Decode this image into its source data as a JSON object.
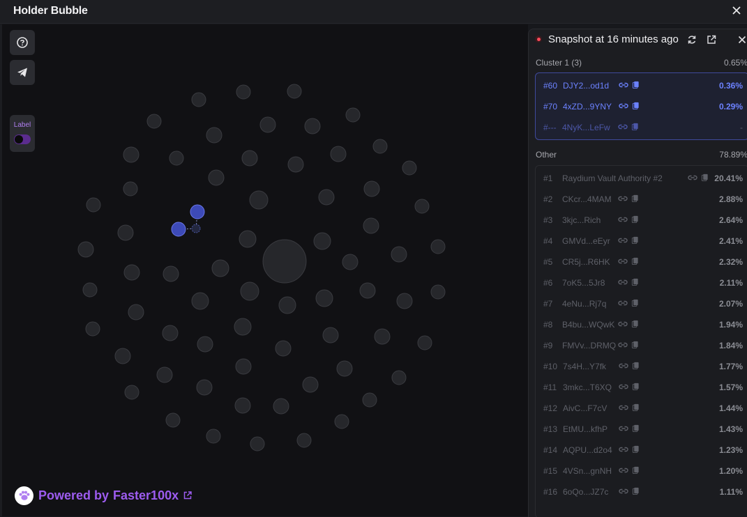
{
  "window": {
    "title": "Holder Bubble"
  },
  "toolbar": {
    "label_text": "Label"
  },
  "footer": {
    "powered_by": "Powered by",
    "brand": "Faster100x"
  },
  "panel": {
    "snapshot_text": "Snapshot at 16 minutes ago",
    "cluster": {
      "label": "Cluster 1 (3)",
      "total": "0.65%",
      "rows": [
        {
          "rank": "#60",
          "address": "DJY2...od1d",
          "percent": "0.36%"
        },
        {
          "rank": "#70",
          "address": "4xZD...9YNY",
          "percent": "0.29%"
        },
        {
          "rank": "#---",
          "address": "4NyK...LeFw",
          "percent": "-"
        }
      ]
    },
    "other": {
      "label": "Other",
      "total": "78.89%",
      "rows": [
        {
          "rank": "#1",
          "address": "Raydium Vault Authority #2",
          "percent": "20.41%"
        },
        {
          "rank": "#2",
          "address": "CKcr...4MAM",
          "percent": "2.88%"
        },
        {
          "rank": "#3",
          "address": "3kjc...Rich",
          "percent": "2.64%"
        },
        {
          "rank": "#4",
          "address": "GMVd...eEyr",
          "percent": "2.41%"
        },
        {
          "rank": "#5",
          "address": "CR5j...R6HK",
          "percent": "2.32%"
        },
        {
          "rank": "#6",
          "address": "7oK5...5Jr8",
          "percent": "2.11%"
        },
        {
          "rank": "#7",
          "address": "4eNu...Rj7q",
          "percent": "2.07%"
        },
        {
          "rank": "#8",
          "address": "B4bu...WQwK",
          "percent": "1.94%"
        },
        {
          "rank": "#9",
          "address": "FMVv...DRMQ",
          "percent": "1.84%"
        },
        {
          "rank": "#10",
          "address": "7s4H...Y7fk",
          "percent": "1.77%"
        },
        {
          "rank": "#11",
          "address": "3mkc...T6XQ",
          "percent": "1.57%"
        },
        {
          "rank": "#12",
          "address": "AivC...F7cV",
          "percent": "1.44%"
        },
        {
          "rank": "#13",
          "address": "EtMU...kfhP",
          "percent": "1.43%"
        },
        {
          "rank": "#14",
          "address": "AQPU...d2o4",
          "percent": "1.23%"
        },
        {
          "rank": "#15",
          "address": "4VSn...gnNH",
          "percent": "1.20%"
        },
        {
          "rank": "#16",
          "address": "6oQo...JZ7c",
          "percent": "1.11%"
        }
      ]
    }
  },
  "colors": {
    "highlight": "#6c82ff",
    "brand": "#9d5cf0",
    "bubble_fill": "#26272b",
    "bubble_stroke": "#3a3b40",
    "cluster_bubble": "#3d4ab8",
    "live_dot": "#ff4a5a"
  },
  "icons": [
    "help-icon",
    "telegram-icon",
    "close-icon",
    "refresh-icon",
    "external-link-icon",
    "link-icon",
    "copy-icon",
    "paw-icon"
  ]
}
